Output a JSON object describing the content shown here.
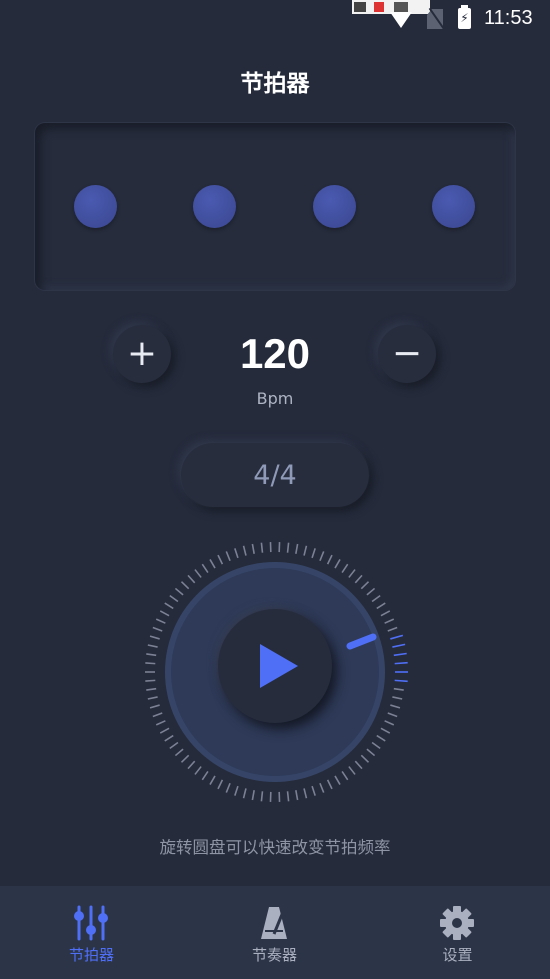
{
  "status_bar": {
    "time": "11:53"
  },
  "header": {
    "title": "节拍器"
  },
  "beats": {
    "count": 4,
    "dot_color": "#4352a4"
  },
  "tempo": {
    "value": "120",
    "unit": "Bpm",
    "increase_symbol": "+",
    "decrease_symbol": "−"
  },
  "time_signature": {
    "label": "4/4"
  },
  "dial": {
    "hint": "旋转圆盘可以快速改变节拍频率",
    "accent_color": "#4f6ff7"
  },
  "tab_bar": {
    "items": [
      {
        "label": "节拍器",
        "icon": "sliders-icon",
        "active": true
      },
      {
        "label": "节奏器",
        "icon": "metronome-icon",
        "active": false
      },
      {
        "label": "设置",
        "icon": "gear-icon",
        "active": false
      }
    ]
  },
  "colors": {
    "background": "#252b3b",
    "accent": "#4f6ff7",
    "tab_bar": "#2c3447"
  }
}
